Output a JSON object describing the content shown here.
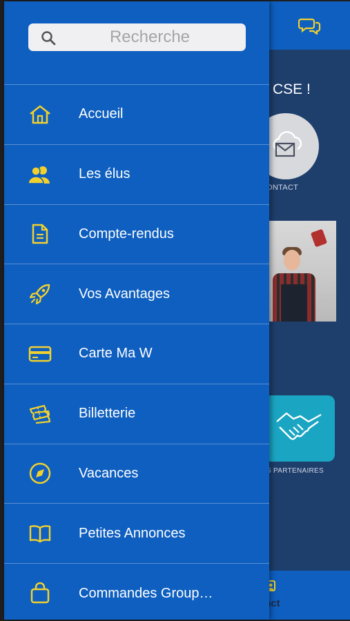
{
  "app": {
    "welcome_text": "CSE !",
    "contact_tile_label": "ONTACT",
    "partner_tile_label": "S PARTENAIRES",
    "bottom_contact_label": "act"
  },
  "drawer": {
    "search": {
      "placeholder": "Recherche",
      "value": ""
    },
    "items": [
      {
        "label": "Accueil",
        "icon": "home-icon"
      },
      {
        "label": "Les élus",
        "icon": "users-icon"
      },
      {
        "label": "Compte-rendus",
        "icon": "document-icon"
      },
      {
        "label": "Vos Avantages",
        "icon": "rocket-icon"
      },
      {
        "label": "Carte Ma W",
        "icon": "credit-card-icon"
      },
      {
        "label": "Billetterie",
        "icon": "ticket-icon"
      },
      {
        "label": "Vacances",
        "icon": "compass-icon"
      },
      {
        "label": "Petites Annonces",
        "icon": "book-icon"
      },
      {
        "label": "Commandes Group…",
        "icon": "bag-icon"
      }
    ]
  },
  "colors": {
    "drawer_bg": "#0e5fc0",
    "icon_accent": "#f2d12e",
    "divider": "#5a8fd3",
    "background_app": "#1e3e6c",
    "partner_tile": "#1aa5c3"
  }
}
